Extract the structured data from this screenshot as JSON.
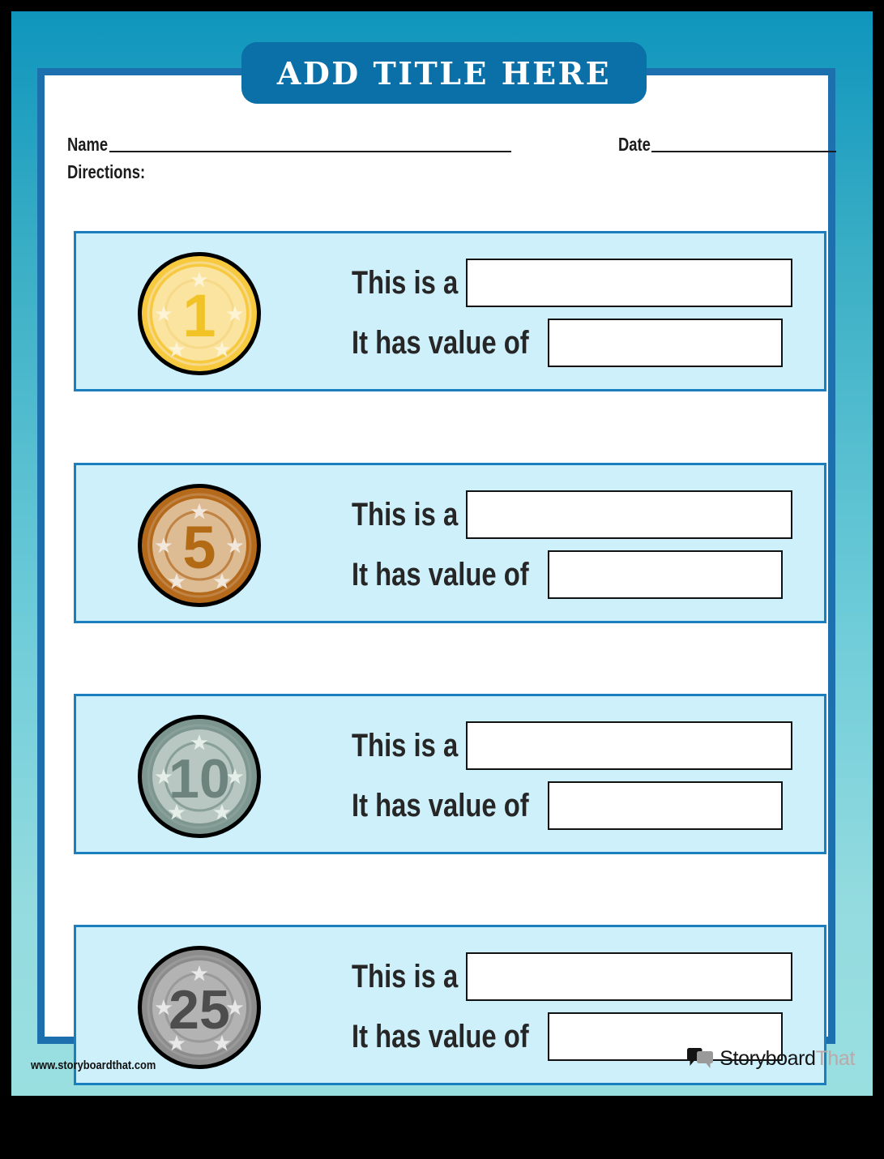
{
  "title": {
    "text": "ADD TITLE HERE"
  },
  "meta": {
    "name_label": "Name",
    "date_label": "Date",
    "directions_label": "Directions:"
  },
  "prompts": {
    "line1": "This is a",
    "line2": "It has value of",
    "answer1_value": "",
    "answer2_value": ""
  },
  "rows": [
    {
      "coin_name": "penny-coin",
      "coin_number": "1",
      "prompt1": "This is a",
      "prompt2": "It has value of",
      "answer1": "",
      "answer2": "",
      "colors": {
        "outline": "#000000",
        "rim": "#f7c93e",
        "face": "#fbe3a0",
        "ring_line": "#f6d989",
        "digit": "#f2c327",
        "star": "#fdf3d5"
      }
    },
    {
      "coin_name": "nickel-coin",
      "coin_number": "5",
      "prompt1": "This is a",
      "prompt2": "It has value of",
      "answer1": "",
      "answer2": "",
      "colors": {
        "outline": "#000000",
        "rim": "#b5691a",
        "face": "#ddbc94",
        "ring_line": "#c08344",
        "digit": "#b26a14",
        "star": "#f2e7dc"
      }
    },
    {
      "coin_name": "dime-coin",
      "coin_number": "10",
      "prompt1": "This is a",
      "prompt2": "It has value of",
      "answer1": "",
      "answer2": "",
      "colors": {
        "outline": "#000000",
        "rim": "#7e9690",
        "face": "#b8c7c1",
        "ring_line": "#88a099",
        "digit": "#6d847e",
        "star": "#e6eeea"
      }
    },
    {
      "coin_name": "quarter-coin",
      "coin_number": "25",
      "prompt1": "This is a",
      "prompt2": "It has value of",
      "answer1": "",
      "answer2": "",
      "colors": {
        "outline": "#000000",
        "rim": "#8c8c8c",
        "face": "#b3b3b3",
        "ring_line": "#9a9a9a",
        "digit": "#4d4d4d",
        "star": "#e8e8e8"
      }
    }
  ],
  "footer": {
    "url": "www.storyboardthat.com",
    "logo_word_primary": "Storyboard",
    "logo_word_secondary": "That"
  },
  "theme": {
    "background_top": "#0f95bd",
    "background_bottom": "#9adfe0",
    "frame_blue": "#1b70ad",
    "title_blue": "#0b6fa8",
    "row_border": "#1b7fbf",
    "row_fill": "#cdf0fb",
    "text_dark": "#262626"
  }
}
